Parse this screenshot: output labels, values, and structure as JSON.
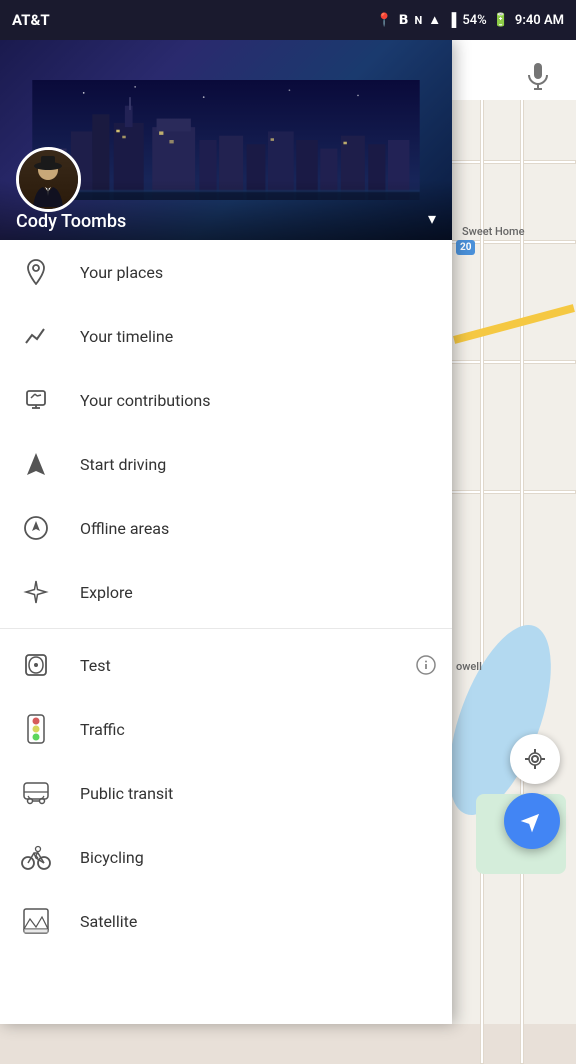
{
  "statusBar": {
    "carrier": "AT&T",
    "time": "9:40 AM",
    "battery": "54%",
    "icons": [
      "location",
      "bluetooth",
      "nfc",
      "wifi",
      "signal"
    ]
  },
  "header": {
    "userName": "Cody Toombs",
    "dropdownArrow": "▾"
  },
  "search": {
    "micIcon": "🎤"
  },
  "menuItems": [
    {
      "id": "your-places",
      "icon": "📍",
      "label": "Your places",
      "hasInfo": false
    },
    {
      "id": "your-timeline",
      "icon": "📈",
      "label": "Your timeline",
      "hasInfo": false
    },
    {
      "id": "your-contributions",
      "icon": "✏️",
      "label": "Your contributions",
      "hasInfo": false
    },
    {
      "id": "start-driving",
      "icon": "▲",
      "label": "Start driving",
      "hasInfo": false
    },
    {
      "id": "offline-areas",
      "icon": "⚡",
      "label": "Offline areas",
      "hasInfo": false
    },
    {
      "id": "explore",
      "icon": "✦",
      "label": "Explore",
      "hasInfo": false
    }
  ],
  "divider": true,
  "mapLayerItems": [
    {
      "id": "test",
      "icon": "📍",
      "label": "Test",
      "hasInfo": true
    },
    {
      "id": "traffic",
      "icon": "🚦",
      "label": "Traffic",
      "hasInfo": false
    },
    {
      "id": "public-transit",
      "icon": "🚌",
      "label": "Public transit",
      "hasInfo": false
    },
    {
      "id": "bicycling",
      "icon": "🚴",
      "label": "Bicycling",
      "hasInfo": false
    },
    {
      "id": "satellite",
      "icon": "🛰️",
      "label": "Satellite",
      "hasInfo": false
    }
  ],
  "map": {
    "locationIcon": "◎",
    "navIcon": "◆",
    "nearbyLabel": "Sweet Home",
    "nearbyLabel2": "owell"
  }
}
